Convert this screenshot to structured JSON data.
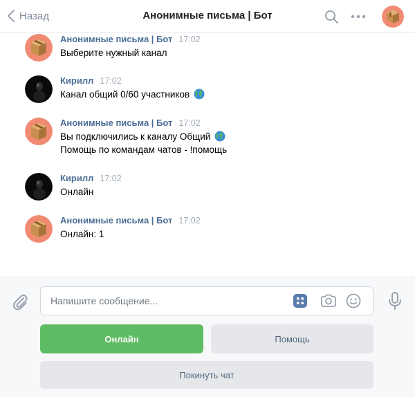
{
  "header": {
    "back_label": "Назад",
    "title": "Анонимные письма | Бот"
  },
  "messages": [
    {
      "author": "Анонимные письма | Бот",
      "time": "17:02",
      "lines": [
        "Выберите нужный канал"
      ],
      "avatar": "box-avatar"
    },
    {
      "author": "Кирилл",
      "time": "17:02",
      "lines": [
        "Канал общий 0/60 участников"
      ],
      "avatar": "dark-avatar"
    },
    {
      "author": "Анонимные письма | Бот",
      "time": "17:02",
      "lines": [
        "Вы подключились к каналу Общий",
        "Помощь по командам чатов - !помощь"
      ],
      "avatar": "box-avatar"
    },
    {
      "author": "Кирилл",
      "time": "17:02",
      "lines": [
        "Онлайн"
      ],
      "avatar": "dark-avatar"
    },
    {
      "author": "Анонимные письма | Бот",
      "time": "17:02",
      "lines": [
        "Онлайн: 1"
      ],
      "avatar": "box-avatar"
    }
  ],
  "composer": {
    "placeholder": "Напишите сообщение...",
    "value": ""
  },
  "keyboard_buttons": {
    "online": "Онлайн",
    "help": "Помощь",
    "leave": "Покинуть чат"
  },
  "colors": {
    "accent_green": "#5ebc64",
    "author_blue": "#4a6d94",
    "secondary_button": "#e5e7ea"
  }
}
